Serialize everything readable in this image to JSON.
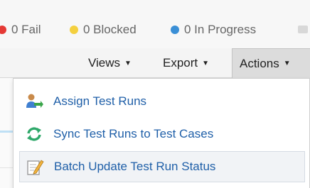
{
  "status": {
    "fail": {
      "label": "0 Fail",
      "color": "#e53935"
    },
    "blocked": {
      "label": "0 Blocked",
      "color": "#f4d03f"
    },
    "in_progress": {
      "label": "0 In Progress",
      "color": "#3a8fd6"
    }
  },
  "toolbar": {
    "views_label": "Views",
    "export_label": "Export",
    "actions_label": "Actions"
  },
  "menu": {
    "items": [
      {
        "label": "Assign Test Runs",
        "icon": "assign-users-icon"
      },
      {
        "label": "Sync Test Runs to Test Cases",
        "icon": "sync-icon"
      },
      {
        "label": "Batch Update Test Run Status",
        "icon": "edit-document-icon"
      }
    ]
  },
  "colors": {
    "link": "#1f5fa8",
    "actions_active_bg": "#dcdcdc"
  }
}
